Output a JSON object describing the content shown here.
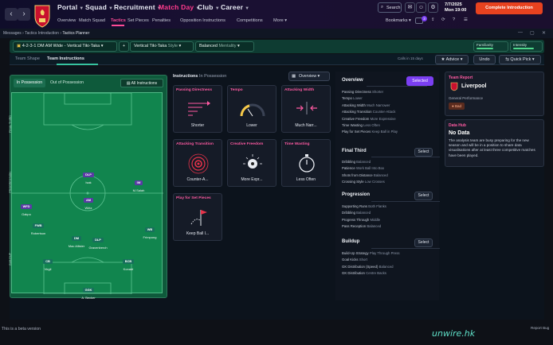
{
  "header": {
    "nav": [
      {
        "label": "Portal"
      },
      {
        "label": "Squad"
      },
      {
        "label": "Recruitment"
      },
      {
        "label": "Match Day"
      },
      {
        "label": "Club"
      },
      {
        "label": "Career"
      }
    ],
    "subnav": [
      "Overview",
      "Match Squad",
      "Tactics",
      "Set Pieces",
      "Penalties",
      "Opposition Instructions",
      "Competitions",
      "More"
    ],
    "search_label": "Search",
    "bookmarks_label": "Bookmarks",
    "notification_count": "3",
    "date_line1": "7/7/2025",
    "date_line2": "Mon  19:00",
    "continue_label": "Complete Introduction"
  },
  "breadcrumb": {
    "items": [
      "Messages",
      "Tactics Introduction",
      "Tactics Planner"
    ]
  },
  "tactic_bar": {
    "formation": "4-2-3-1 DM AM Wide - Vertical Tiki-Taka",
    "add_label": "+",
    "style_value": "Vertical Tiki-Taka",
    "style_label": "Style",
    "mentality_value": "Balanced",
    "mentality_label": "Mentality",
    "familiarity_label": "Familiarity",
    "familiarity_level": 0.55,
    "intensity_label": "Intensity",
    "intensity_level": 0.75
  },
  "tabs": {
    "items": [
      "Team Shape",
      "Team Instructions"
    ],
    "active": "Team Instructions",
    "calls_text": "Calls  in 15 days",
    "advice_label": "Advice",
    "undo_label": "Undo",
    "quickpick_label": "Quick Pick"
  },
  "pitch": {
    "in_possession": "In Possession",
    "out_possession": "Out of Possession",
    "all_instructions": "All Instructions",
    "zones": [
      "FINAL THIRD",
      "PROGRESSION",
      "BUILDUP"
    ],
    "players": [
      {
        "role": "DLP",
        "name": "Isak"
      },
      {
        "role": "IW",
        "name": "M.Salah"
      },
      {
        "role": "AM",
        "name": "Wirtz"
      },
      {
        "role": "WFD",
        "name": "Gakpo"
      },
      {
        "role": "FWB",
        "name": "Robertson"
      },
      {
        "role": "WB",
        "name": "Frimpong"
      },
      {
        "role": "DM",
        "name": "Mac Allister"
      },
      {
        "role": "DLP",
        "name": "Gravenberch"
      },
      {
        "role": "CB",
        "name": "Virgil"
      },
      {
        "role": "BCB",
        "name": "Konaté"
      },
      {
        "role": "GGK",
        "name": "A. Becker"
      }
    ]
  },
  "instructions": {
    "title": "Instructions",
    "subtitle": "In Possession",
    "overview_btn": "Overview",
    "cards": [
      {
        "title": "Passing Directness",
        "value": "Shorter"
      },
      {
        "title": "Tempo",
        "value": "Lower"
      },
      {
        "title": "Attacking Width",
        "value": "Much Narr..."
      },
      {
        "title": "Attacking Transition",
        "value": "Counter-A..."
      },
      {
        "title": "Creative Freedom",
        "value": "More Expr..."
      },
      {
        "title": "Time Wasting",
        "value": "Less Often"
      },
      {
        "title": "Play for Set Pieces",
        "value": "Keep Ball I..."
      }
    ]
  },
  "overview": {
    "title": "Overview",
    "selected_label": "Selected",
    "select_label": "Select",
    "groups": [
      {
        "title": "Overview",
        "rows": [
          [
            "Passing Directness",
            "Shorter"
          ],
          [
            "Tempo",
            "Lower"
          ],
          [
            "Attacking Width",
            "Much Narrower"
          ],
          [
            "Attacking Transition",
            "Counter-Attack"
          ],
          [
            "Creative Freedom",
            "More Expressive"
          ],
          [
            "Time Wasting",
            "Less Often"
          ],
          [
            "Play for Set Pieces",
            "Keep Ball in Play"
          ]
        ]
      },
      {
        "title": "Final Third",
        "rows": [
          [
            "Dribbling",
            "Balanced"
          ],
          [
            "Patience",
            "Work Ball Into Box"
          ],
          [
            "Shots from Distance",
            "Balanced"
          ],
          [
            "Crossing Style",
            "Low Crosses"
          ]
        ]
      },
      {
        "title": "Progression",
        "rows": [
          [
            "Supporting Runs",
            "Both Flanks"
          ],
          [
            "Dribbling",
            "Balanced"
          ],
          [
            "Progress Through",
            "Middle"
          ],
          [
            "Pass Reception",
            "Balanced"
          ]
        ]
      },
      {
        "title": "Buildup",
        "rows": [
          [
            "Build-Up Strategy",
            "Play Through Press"
          ],
          [
            "Goal Kicks",
            "Short"
          ],
          [
            "GK Distribution (Speed)",
            "Balanced"
          ],
          [
            "GK Distribution",
            "Centre Backs"
          ]
        ]
      }
    ]
  },
  "team_report": {
    "title": "Team Report",
    "club": "Liverpool",
    "general_label": "General Performance",
    "badge": "Bad"
  },
  "data_hub": {
    "title": "Data Hub",
    "heading": "No Data",
    "text": "The analysis team are busy preparing for the new season and will be in a position to share data visualisations after at least three competitive matches have been played."
  },
  "footer": {
    "beta": "This is a beta version",
    "report": "Report Bug",
    "watermark": "unwire.hk"
  },
  "colors": {
    "accent_pink": "#ff4b96",
    "continue_orange": "#e8421f",
    "selected_purple": "#7b3ff2",
    "pitch_green": "#11854e"
  }
}
